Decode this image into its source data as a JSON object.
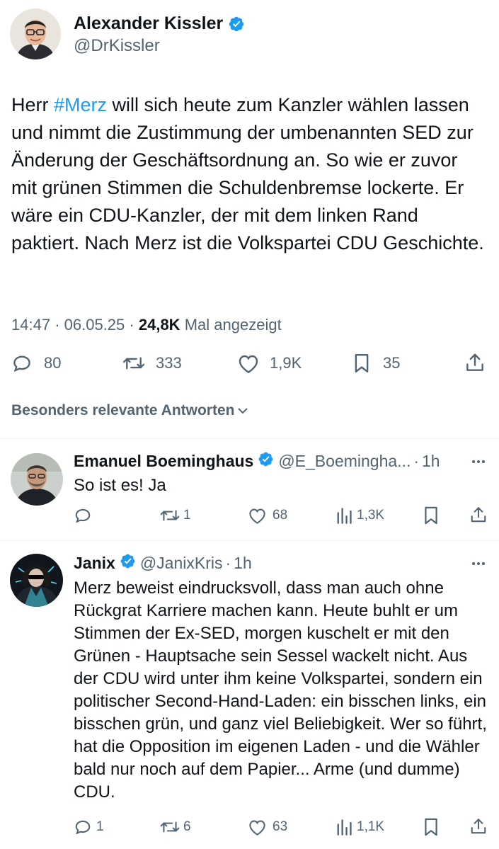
{
  "main_tweet": {
    "author_name": "Alexander Kissler",
    "author_handle": "@DrKissler",
    "text_prefix": "Herr ",
    "hashtag": "#Merz",
    "text_rest": " will sich heute zum Kanzler wählen lassen und nimmt die Zustimmung der umbenannten SED zur Änderung der Geschäftsordnung an. So wie er zuvor mit grünen Stimmen die Schuldenbremse lockerte. Er wäre ein CDU-Kanzler, der mit dem linken Rand paktiert. Nach Merz ist die Volkspartei CDU Geschichte.",
    "time": "14:47",
    "date": "06.05.25",
    "views_count": "24,8K",
    "views_label": "Mal angezeigt",
    "separator": "·",
    "replies": "80",
    "reposts": "333",
    "likes": "1,9K",
    "bookmarks": "35"
  },
  "replies_sort": {
    "label": "Besonders relevante Antworten"
  },
  "replies": [
    {
      "author_name": "Emanuel Boeminghaus",
      "author_handle": "@E_Boemingha...",
      "time": "1h",
      "text": "So ist es! Ja",
      "replies": "",
      "reposts": "1",
      "likes": "68",
      "views": "1,3K"
    },
    {
      "author_name": "Janix",
      "author_handle": "@JanixKris",
      "time": "1h",
      "text": "Merz beweist eindrucksvoll, dass man auch ohne Rückgrat Karriere machen kann. Heute buhlt er um Stimmen der Ex-SED, morgen kuschelt er mit den Grünen - Hauptsache sein Sessel wackelt nicht. Aus der CDU wird unter ihm keine Volkspartei, sondern ein politischer Second-Hand-Laden: ein bisschen links, ein bisschen grün, und ganz viel Beliebigkeit. Wer so führt, hat die Opposition im eigenen Laden - und die Wähler bald nur noch auf dem Papier... Arme (und dumme) CDU.",
      "replies": "1",
      "reposts": "6",
      "likes": "63",
      "views": "1,1K"
    }
  ],
  "colors": {
    "accent": "#1d9bf0",
    "text": "#0f1419",
    "secondary": "#536471",
    "divider": "#eff3f4"
  },
  "icons": [
    "verified-badge-icon",
    "reply-icon",
    "repost-icon",
    "like-icon",
    "bookmark-icon",
    "share-icon",
    "views-icon",
    "chevron-down-icon",
    "more-icon"
  ]
}
